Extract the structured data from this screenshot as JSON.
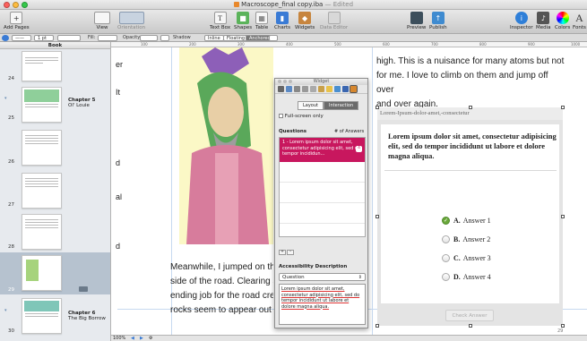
{
  "window": {
    "title": "Macroscope_final copy.iba",
    "edited": "— Edited"
  },
  "toolbar": {
    "add_pages": "Add Pages",
    "view": "View",
    "orientation": "Orientation",
    "text_box": "Text Box",
    "shapes": "Shapes",
    "table": "Table",
    "charts": "Charts",
    "widgets": "Widgets",
    "data_editor": "Data Editor",
    "preview": "Preview",
    "publish": "Publish",
    "inspector": "Inspector",
    "media": "Media",
    "colors": "Colors",
    "fonts": "Fonts"
  },
  "formatbar": {
    "fill": "Fill:",
    "opacity": "Opacity:",
    "shadow": "Shadow",
    "inline": "Inline",
    "floating": "Floating",
    "anchored": "Anchored",
    "pt": "1 pt"
  },
  "sidebar": {
    "header": "Book",
    "pages": [
      {
        "num": "24"
      },
      {
        "num": "25",
        "chapter": "Chapter 5",
        "name": "Ol' Louie"
      },
      {
        "num": "26"
      },
      {
        "num": "27"
      },
      {
        "num": "28"
      },
      {
        "num": "29"
      },
      {
        "num": "30",
        "chapter": "Chapter 6",
        "name": "The Big Borrow"
      }
    ]
  },
  "ruler": [
    "100",
    "200",
    "300",
    "400",
    "500",
    "600",
    "700",
    "800",
    "900",
    "1000"
  ],
  "page": {
    "top_lines": [
      "high. This is a nuisance for many atoms but not",
      "for me. I love to climb on them and jump off over",
      "and over again."
    ],
    "left_fragments": [
      "er",
      "It",
      "d",
      "al",
      "d"
    ],
    "bottom_lines": [
      "Meanwhile, I jumped on the",
      "side of the road. Clearing s",
      "ending job for the road crew",
      "rocks seem to appear out o"
    ]
  },
  "widget": {
    "header": "Lorem-Ipsum-dolor-amet,-consectetur",
    "question": "Lorem ipsum dolor sit amet, consectetur adipisicing elit, sed do tempor incididunt ut labore et dolore magna aliqua.",
    "answers": [
      {
        "letter": "A.",
        "text": "Answer 1",
        "checked": true
      },
      {
        "letter": "B.",
        "text": "Answer 2",
        "checked": false
      },
      {
        "letter": "C.",
        "text": "Answer 3",
        "checked": false
      },
      {
        "letter": "D.",
        "text": "Answer 4",
        "checked": false
      }
    ],
    "check_button": "Check Answer",
    "page_num": "29"
  },
  "inspector": {
    "title": "Widget",
    "tab_layout": "Layout",
    "tab_interaction": "Interaction",
    "fullscreen": "Full-screen only",
    "questions_label": "Questions",
    "answers_label": "# of Answers",
    "selected_question": "1 - Lorem ipsum dolor sit amet, consectetur adipisicing elit, sed do tempor incididun...",
    "selected_answers": "4",
    "accessibility_label": "Accessibility Description",
    "access_select": "Question",
    "access_text": "Lorem ipsum dolor sit amet, consectetur adipisicing elit, sed do tempor incididunt ut labore et dolore magna aliqua."
  },
  "status": {
    "zoom": "100%"
  }
}
